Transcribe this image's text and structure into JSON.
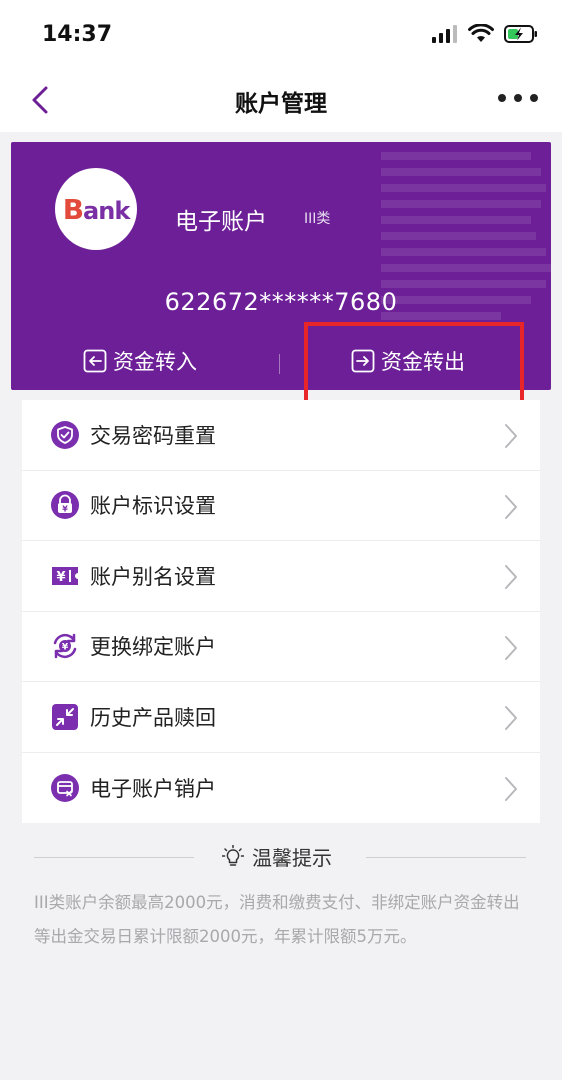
{
  "status_bar": {
    "time": "14:37"
  },
  "nav": {
    "title": "账户管理"
  },
  "card": {
    "logo_first": "B",
    "logo_rest": "ank",
    "account_name": "电子账户",
    "account_class": "III类",
    "account_number": "622672******7680",
    "transfer_in": "资金转入",
    "transfer_out": "资金转出"
  },
  "menu": {
    "items": [
      {
        "label": "交易密码重置",
        "icon": "shield-icon"
      },
      {
        "label": "账户标识设置",
        "icon": "lock-yuan-icon"
      },
      {
        "label": "账户别名设置",
        "icon": "yuan-ticket-icon"
      },
      {
        "label": "更换绑定账户",
        "icon": "exchange-yuan-icon"
      },
      {
        "label": "历史产品赎回",
        "icon": "shrink-arrows-icon"
      },
      {
        "label": "电子账户销户",
        "icon": "card-close-icon"
      }
    ]
  },
  "tips": {
    "title": "温馨提示",
    "text": "III类账户余额最高2000元，消费和缴费支付、非绑定账户资金转出等出金交易日累计限额2000元，年累计限额5万元。"
  },
  "colors": {
    "brand": "#6c1f97",
    "highlight": "#e8262a",
    "icon": "#7b2fae"
  }
}
